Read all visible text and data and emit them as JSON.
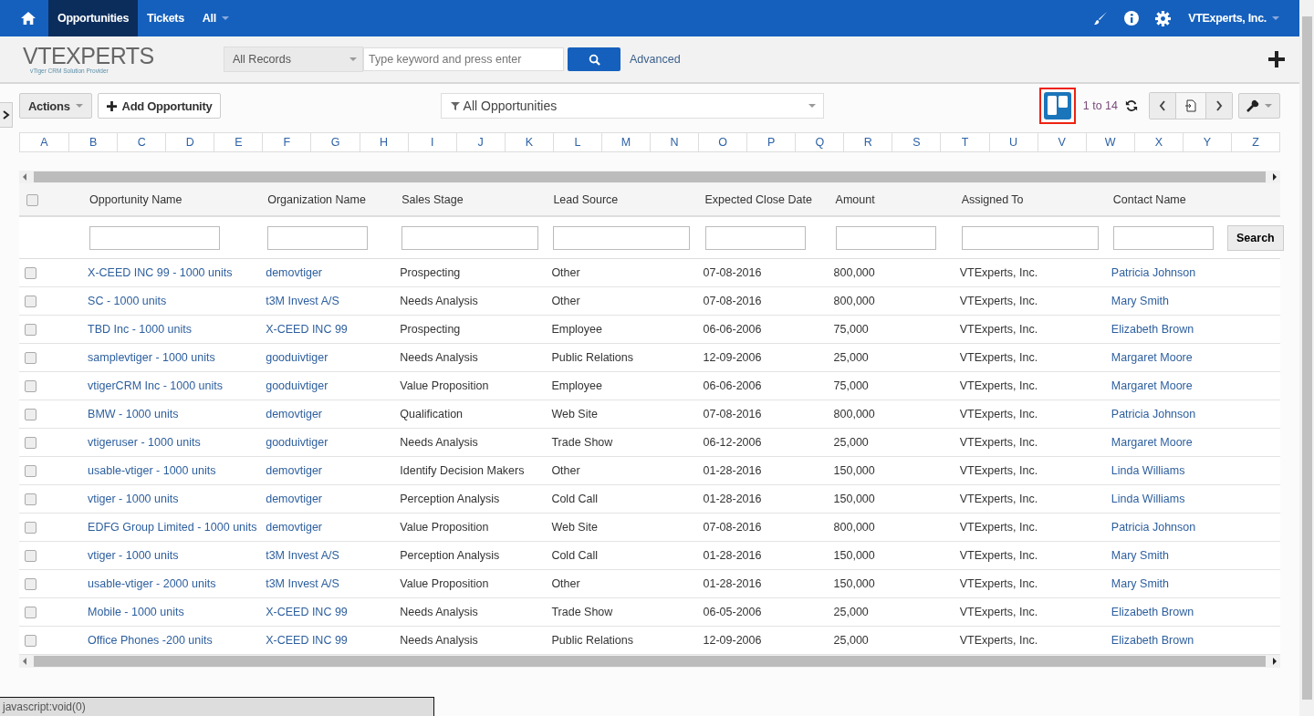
{
  "top_nav": {
    "tabs": [
      {
        "label": "Opportunities",
        "selected": true
      },
      {
        "label": "Tickets",
        "selected": false
      }
    ],
    "menu": "All",
    "user": "VTExperts, Inc."
  },
  "header": {
    "logo": {
      "name": "VTEXPERTS",
      "tagline": "vTiger CRM Solution Provider"
    },
    "scope": "All Records",
    "search": {
      "placeholder": "Type keyword and press enter"
    },
    "advanced": "Advanced"
  },
  "toolbar": {
    "actions": "Actions",
    "add": "Add Opportunity",
    "filter": "All Opportunities",
    "paging": "1 to 14"
  },
  "alphabet": [
    "A",
    "B",
    "C",
    "D",
    "E",
    "F",
    "G",
    "H",
    "I",
    "J",
    "K",
    "L",
    "M",
    "N",
    "O",
    "P",
    "Q",
    "R",
    "S",
    "T",
    "U",
    "V",
    "W",
    "X",
    "Y",
    "Z"
  ],
  "table": {
    "columns": [
      {
        "label": "Opportunity Name",
        "link": true
      },
      {
        "label": "Organization Name",
        "link": true
      },
      {
        "label": "Sales Stage",
        "link": false
      },
      {
        "label": "Lead Source",
        "link": false
      },
      {
        "label": "Expected Close Date",
        "link": false
      },
      {
        "label": "Amount",
        "link": false
      },
      {
        "label": "Assigned To",
        "link": false
      },
      {
        "label": "Contact Name",
        "link": true
      }
    ],
    "search_button": "Search",
    "select_all_checked": false,
    "rows": [
      {
        "checked": false,
        "cells": [
          "X-CEED INC 99 - 1000 units",
          "demovtiger",
          "Prospecting",
          "Other",
          "07-08-2016",
          "800,000",
          "VTExperts, Inc.",
          "Patricia Johnson"
        ]
      },
      {
        "checked": false,
        "cells": [
          "SC - 1000 units",
          "t3M Invest A/S",
          "Needs Analysis",
          "Other",
          "07-08-2016",
          "800,000",
          "VTExperts, Inc.",
          "Mary Smith"
        ]
      },
      {
        "checked": false,
        "cells": [
          "TBD Inc - 1000 units",
          "X-CEED INC 99",
          "Prospecting",
          "Employee",
          "06-06-2006",
          "75,000",
          "VTExperts, Inc.",
          "Elizabeth Brown"
        ]
      },
      {
        "checked": false,
        "cells": [
          "samplevtiger - 1000 units",
          "gooduivtiger",
          "Needs Analysis",
          "Public Relations",
          "12-09-2006",
          "25,000",
          "VTExperts, Inc.",
          "Margaret Moore"
        ]
      },
      {
        "checked": false,
        "cells": [
          "vtigerCRM Inc - 1000 units",
          "gooduivtiger",
          "Value Proposition",
          "Employee",
          "06-06-2006",
          "75,000",
          "VTExperts, Inc.",
          "Margaret Moore"
        ]
      },
      {
        "checked": false,
        "cells": [
          "BMW - 1000 units",
          "demovtiger",
          "Qualification",
          "Web Site",
          "07-08-2016",
          "800,000",
          "VTExperts, Inc.",
          "Patricia Johnson"
        ]
      },
      {
        "checked": false,
        "cells": [
          "vtigeruser - 1000 units",
          "gooduivtiger",
          "Needs Analysis",
          "Trade Show",
          "06-12-2006",
          "25,000",
          "VTExperts, Inc.",
          "Margaret Moore"
        ]
      },
      {
        "checked": false,
        "cells": [
          "usable-vtiger - 1000 units",
          "demovtiger",
          "Identify Decision Makers",
          "Other",
          "01-28-2016",
          "150,000",
          "VTExperts, Inc.",
          "Linda Williams"
        ]
      },
      {
        "checked": false,
        "cells": [
          "vtiger - 1000 units",
          "demovtiger",
          "Perception Analysis",
          "Cold Call",
          "01-28-2016",
          "150,000",
          "VTExperts, Inc.",
          "Linda Williams"
        ]
      },
      {
        "checked": false,
        "cells": [
          "EDFG Group Limited - 1000 units",
          "demovtiger",
          "Value Proposition",
          "Web Site",
          "07-08-2016",
          "800,000",
          "VTExperts, Inc.",
          "Patricia Johnson"
        ]
      },
      {
        "checked": false,
        "cells": [
          "vtiger - 1000 units",
          "t3M Invest A/S",
          "Perception Analysis",
          "Cold Call",
          "01-28-2016",
          "150,000",
          "VTExperts, Inc.",
          "Mary Smith"
        ]
      },
      {
        "checked": false,
        "cells": [
          "usable-vtiger - 2000 units",
          "t3M Invest A/S",
          "Value Proposition",
          "Other",
          "01-28-2016",
          "150,000",
          "VTExperts, Inc.",
          "Mary Smith"
        ]
      },
      {
        "checked": false,
        "cells": [
          "Mobile - 1000 units",
          "X-CEED INC 99",
          "Needs Analysis",
          "Trade Show",
          "06-05-2006",
          "25,000",
          "VTExperts, Inc.",
          "Elizabeth Brown"
        ]
      },
      {
        "checked": false,
        "cells": [
          "Office Phones -200 units",
          "X-CEED INC 99",
          "Needs Analysis",
          "Public Relations",
          "12-09-2006",
          "25,000",
          "VTExperts, Inc.",
          "Elizabeth Brown"
        ]
      }
    ]
  },
  "status_bar": "javascript:void(0)"
}
